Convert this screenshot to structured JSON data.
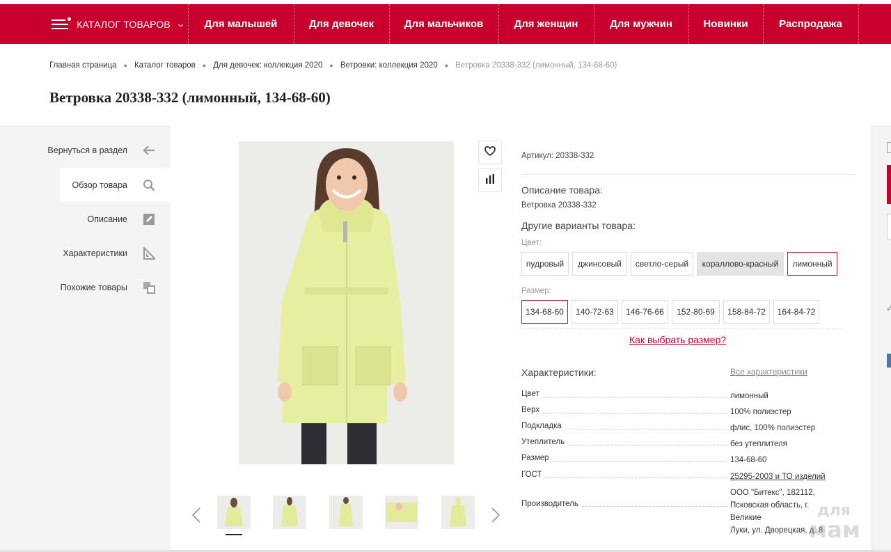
{
  "nav": {
    "catalog_label": "КАТАЛОГ ТОВАРОВ",
    "items": [
      "Для малышей",
      "Для девочек",
      "Для мальчиков",
      "Для женщин",
      "Для мужчин",
      "Новинки",
      "Распродажа"
    ]
  },
  "breadcrumb": [
    "Главная страница",
    "Каталог товаров",
    "Для девочек: коллекция 2020",
    "Ветровки: коллекция 2020",
    "Ветровка 20338-332 (лимонный, 134-68-60)"
  ],
  "title": "Ветровка 20338-332 (лимонный, 134-68-60)",
  "sidebar": [
    "Вернуться в раздел",
    "Обзор товара",
    "Описание",
    "Характеристики",
    "Похожие товары"
  ],
  "product": {
    "sku": "Артикул: 20338-332",
    "desc_heading": "Описание товара:",
    "desc_text": "Ветровка 20338-332",
    "variants_heading": "Другие варианты товара:",
    "color_label": "Цвет:",
    "colors": [
      "пудровый",
      "джинсовый",
      "светло-серый",
      "кораллово-красный",
      "лимонный"
    ],
    "size_label": "Размер:",
    "sizes": [
      "134-68-60",
      "140-72-63",
      "146-76-66",
      "152-80-69",
      "158-84-72",
      "164-84-72"
    ],
    "size_help": "Как выбрать размер?"
  },
  "specs": {
    "heading": "Характеристики:",
    "all_link": "Все характеристики",
    "rows": [
      {
        "k": "Цвет",
        "v": "лимонный"
      },
      {
        "k": "Верх",
        "v": "100% полиэстер"
      },
      {
        "k": "Подкладка",
        "v": "флис, 100% полиэстер"
      },
      {
        "k": "Утеплитель",
        "v": "без утеплителя"
      },
      {
        "k": "Размер",
        "v": "134-68-60"
      },
      {
        "k": "ГОСТ",
        "v": "25295-2003 и ТО изделий"
      }
    ],
    "maker_k": "Производитель",
    "maker_v": [
      "ООО \"Битекс\", 182112,",
      "Псковская область, г. Великие",
      "Луки, ул. Дворецкая, д. 8"
    ]
  },
  "watermark": [
    "для",
    "мам"
  ],
  "colors": {
    "brand_red": "#c9002d",
    "selected_border": "#b5213e",
    "jacket": "#e9f0a8"
  }
}
